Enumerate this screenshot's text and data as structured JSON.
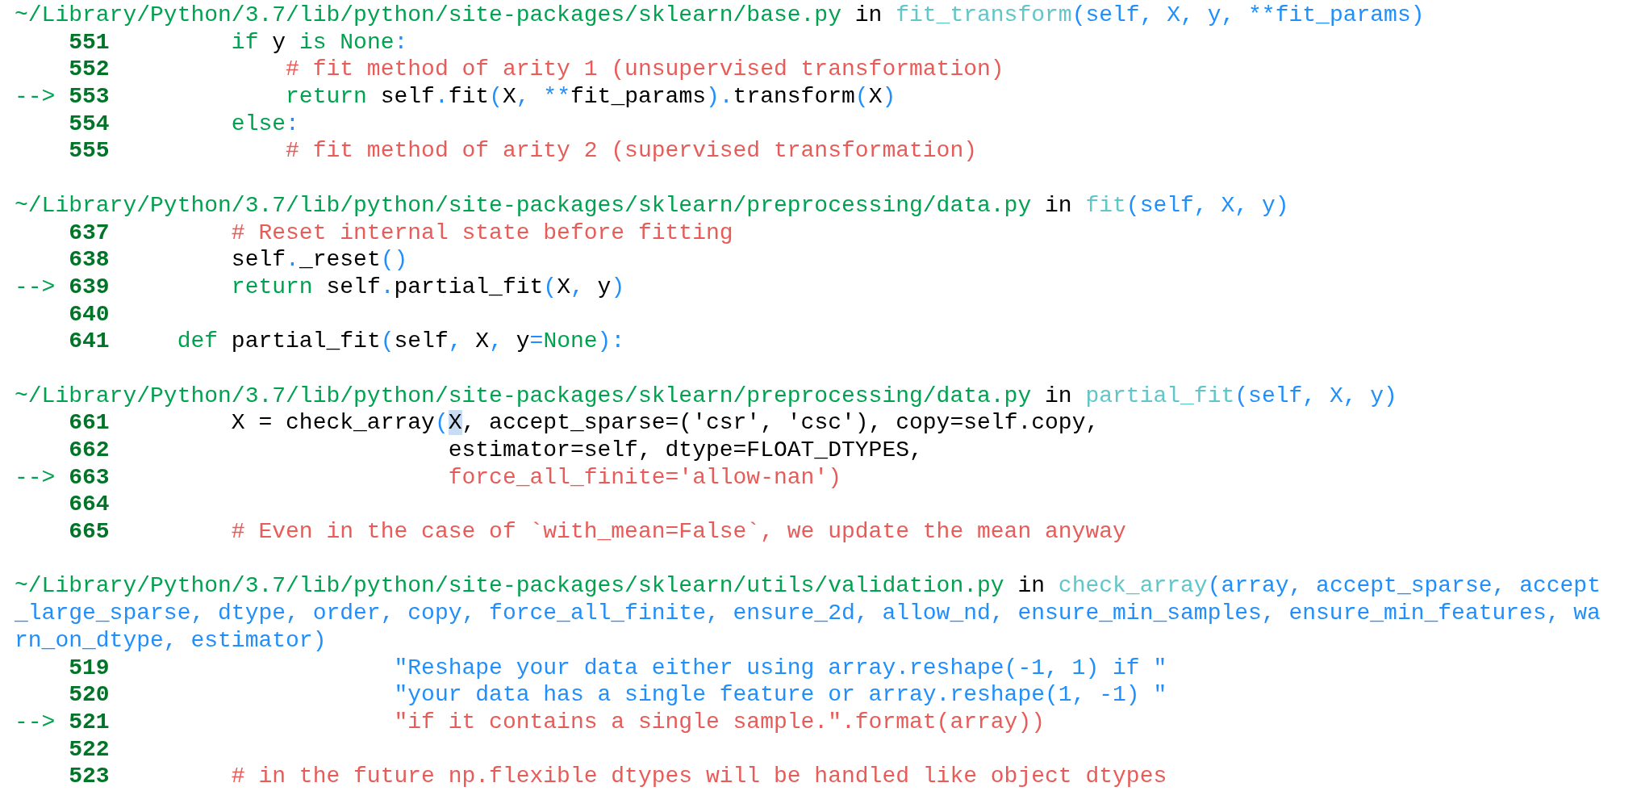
{
  "frames": [
    {
      "header": [
        {
          "kind": "path",
          "text": "~/Library/Python/3.7/lib/python/site-packages/sklearn/base.py"
        },
        {
          "kind": "plain",
          "text": " in "
        },
        {
          "kind": "func",
          "text": "fit_transform"
        },
        {
          "kind": "args",
          "text": "(self, X, y, **fit_params)"
        }
      ],
      "lines": [
        {
          "number": "551",
          "code": [
            {
              "kind": "kw",
              "text": "        if"
            },
            {
              "kind": "plain",
              "text": " y "
            },
            {
              "kind": "kw",
              "text": "is None"
            },
            {
              "kind": "op",
              "text": ":"
            }
          ]
        },
        {
          "number": "552",
          "code": [
            {
              "kind": "comment",
              "text": "            # fit method of arity 1 (unsupervised transformation)"
            }
          ]
        },
        {
          "number": "553",
          "marker": "-->",
          "code": [
            {
              "kind": "kw",
              "text": "            return"
            },
            {
              "kind": "plain",
              "text": " self"
            },
            {
              "kind": "op",
              "text": "."
            },
            {
              "kind": "plain",
              "text": "fit"
            },
            {
              "kind": "op",
              "text": "("
            },
            {
              "kind": "plain",
              "text": "X"
            },
            {
              "kind": "op",
              "text": ", **"
            },
            {
              "kind": "plain",
              "text": "fit_params"
            },
            {
              "kind": "op",
              "text": ")."
            },
            {
              "kind": "plain",
              "text": "transform"
            },
            {
              "kind": "op",
              "text": "("
            },
            {
              "kind": "plain",
              "text": "X"
            },
            {
              "kind": "op",
              "text": ")"
            }
          ]
        },
        {
          "number": "554",
          "code": [
            {
              "kind": "kw",
              "text": "        else"
            },
            {
              "kind": "op",
              "text": ":"
            }
          ]
        },
        {
          "number": "555",
          "code": [
            {
              "kind": "comment",
              "text": "            # fit method of arity 2 (supervised transformation)"
            }
          ]
        }
      ]
    },
    {
      "header": [
        {
          "kind": "path",
          "text": "~/Library/Python/3.7/lib/python/site-packages/sklearn/preprocessing/data.py"
        },
        {
          "kind": "plain",
          "text": " in "
        },
        {
          "kind": "func",
          "text": "fit"
        },
        {
          "kind": "args",
          "text": "(self, X, y)"
        }
      ],
      "lines": [
        {
          "number": "637",
          "code": [
            {
              "kind": "comment",
              "text": "        # Reset internal state before fitting"
            }
          ]
        },
        {
          "number": "638",
          "code": [
            {
              "kind": "plain",
              "text": "        self"
            },
            {
              "kind": "op",
              "text": "."
            },
            {
              "kind": "plain",
              "text": "_reset"
            },
            {
              "kind": "op",
              "text": "()"
            }
          ]
        },
        {
          "number": "639",
          "marker": "-->",
          "code": [
            {
              "kind": "kw",
              "text": "        return"
            },
            {
              "kind": "plain",
              "text": " self"
            },
            {
              "kind": "op",
              "text": "."
            },
            {
              "kind": "plain",
              "text": "partial_fit"
            },
            {
              "kind": "op",
              "text": "("
            },
            {
              "kind": "plain",
              "text": "X"
            },
            {
              "kind": "op",
              "text": ", "
            },
            {
              "kind": "plain",
              "text": "y"
            },
            {
              "kind": "op",
              "text": ")"
            }
          ]
        },
        {
          "number": "640"
        },
        {
          "number": "641",
          "code": [
            {
              "kind": "kw",
              "text": "    def"
            },
            {
              "kind": "plain",
              "text": " partial_fit"
            },
            {
              "kind": "op",
              "text": "("
            },
            {
              "kind": "plain",
              "text": "self"
            },
            {
              "kind": "op",
              "text": ", "
            },
            {
              "kind": "plain",
              "text": "X"
            },
            {
              "kind": "op",
              "text": ", "
            },
            {
              "kind": "plain",
              "text": "y"
            },
            {
              "kind": "op",
              "text": "="
            },
            {
              "kind": "kw",
              "text": "None"
            },
            {
              "kind": "op",
              "text": "):"
            }
          ]
        }
      ]
    },
    {
      "header": [
        {
          "kind": "path",
          "text": "~/Library/Python/3.7/lib/python/site-packages/sklearn/preprocessing/data.py"
        },
        {
          "kind": "plain",
          "text": " in "
        },
        {
          "kind": "func",
          "text": "partial_fit"
        },
        {
          "kind": "args",
          "text": "(self, X, y)"
        }
      ],
      "lines": [
        {
          "number": "661",
          "code": [
            {
              "kind": "plain",
              "text": "        X = check_array"
            },
            {
              "kind": "op",
              "text": "("
            },
            {
              "kind": "cursor",
              "text": "X"
            },
            {
              "kind": "plain",
              "text": ", accept_sparse=('csr', 'csc'), copy=self.copy,"
            }
          ]
        },
        {
          "number": "662",
          "code": [
            {
              "kind": "plain",
              "text": "                        estimator=self, dtype=FLOAT_DTYPES,"
            }
          ]
        },
        {
          "number": "663",
          "marker": "-->",
          "code": [
            {
              "kind": "error",
              "text": "                        force_all_finite='allow-nan')"
            }
          ]
        },
        {
          "number": "664"
        },
        {
          "number": "665",
          "code": [
            {
              "kind": "comment",
              "text": "        # Even in the case of `with_mean=False`, we update the mean anyway"
            }
          ]
        }
      ]
    },
    {
      "header": [
        {
          "kind": "path",
          "text": "~/Library/Python/3.7/lib/python/site-packages/sklearn/utils/validation.py"
        },
        {
          "kind": "plain",
          "text": " in "
        },
        {
          "kind": "func",
          "text": "check_array"
        },
        {
          "kind": "args",
          "text": "(array, accept_sparse, accept_large_sparse, dtype, order, copy, force_all_finite, ensure_2d, allow_nd, ensure_min_samples, ensure_min_features, warn_on_dtype, estimator)"
        }
      ],
      "lines": [
        {
          "number": "519",
          "code": [
            {
              "kind": "str",
              "text": "                    \"Reshape your data either using array.reshape(-1, 1) if \""
            }
          ]
        },
        {
          "number": "520",
          "code": [
            {
              "kind": "str",
              "text": "                    \"your data has a single feature or array.reshape(1, -1) \""
            }
          ]
        },
        {
          "number": "521",
          "marker": "-->",
          "code": [
            {
              "kind": "error",
              "text": "                    \"if it contains a single sample.\".format(array))"
            }
          ]
        },
        {
          "number": "522"
        },
        {
          "number": "523",
          "code": [
            {
              "kind": "comment",
              "text": "        # in the future np.flexible dtypes will be handled like object dtypes"
            }
          ]
        }
      ]
    }
  ]
}
